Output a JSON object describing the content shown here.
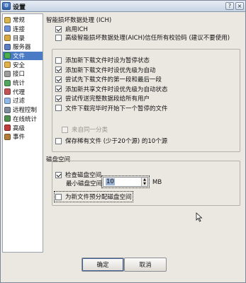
{
  "window": {
    "title": "设置",
    "icon": "app-icon"
  },
  "sidebar": {
    "items": [
      {
        "label": "常规",
        "icon": "general-icon",
        "color": "#d7b44c",
        "selected": false
      },
      {
        "label": "连接",
        "icon": "connection-icon",
        "color": "#6a8fd9",
        "selected": false
      },
      {
        "label": "目录",
        "icon": "folder-icon",
        "color": "#d7a842",
        "selected": false
      },
      {
        "label": "服务器",
        "icon": "server-icon",
        "color": "#5d7ec3",
        "selected": false
      },
      {
        "label": "文件",
        "icon": "file-icon",
        "color": "#4bb04b",
        "selected": true
      },
      {
        "label": "安全",
        "icon": "security-icon",
        "color": "#e0b04a",
        "selected": false
      },
      {
        "label": "接口",
        "icon": "interface-icon",
        "color": "#9d9d9d",
        "selected": false
      },
      {
        "label": "统计",
        "icon": "statistics-icon",
        "color": "#51a65e",
        "selected": false
      },
      {
        "label": "代理",
        "icon": "proxy-icon",
        "color": "#c45454",
        "selected": false
      },
      {
        "label": "过滤",
        "icon": "filter-icon",
        "color": "#8fb7e8",
        "selected": false
      },
      {
        "label": "远程控制",
        "icon": "remote-control-icon",
        "color": "#7f8fa0",
        "selected": false
      },
      {
        "label": "在线统计",
        "icon": "online-statistics-icon",
        "color": "#4f8f4f",
        "selected": false
      },
      {
        "label": "高级",
        "icon": "advanced-icon",
        "color": "#c23a3a",
        "selected": false
      },
      {
        "label": "事件",
        "icon": "events-icon",
        "color": "#b37d39",
        "selected": false
      }
    ]
  },
  "ich": {
    "title": "智能损坏数据处理 (ICH)",
    "enable_label": "启用ICH",
    "enable_checked": true,
    "aich_label": "高级智能损坏数据处理(AICH)信任所有校验码 (建议不要使用)",
    "aich_checked": false
  },
  "files": {
    "options": [
      {
        "label": "添加新下载文件时设为暂停状态",
        "checked": false
      },
      {
        "label": "添加新下载文件时设优先级为自动",
        "checked": true
      },
      {
        "label": "尝试先下载文件的第一段和最后一段",
        "checked": true
      },
      {
        "label": "添加新共享文件时设优先级为自动状态",
        "checked": true
      },
      {
        "label": "尝试传送完整数据段给所有用户",
        "checked": true
      },
      {
        "label": "文件下载完毕时开始下一个暂停的文件",
        "checked": false
      }
    ],
    "same_category_label": "来自同一分类",
    "same_category_checked": false,
    "rare_label": "保存稀有文件 (少于20个源) 的10个源",
    "rare_checked": false
  },
  "disk": {
    "title": "磁盘空间",
    "check_label": "检查磁盘空间",
    "check_checked": true,
    "min_label": "最小磁盘空间：",
    "min_value": "10",
    "min_unit": "MB",
    "prealloc_label": "为新文件预分配磁盘空间",
    "prealloc_checked": false
  },
  "buttons": {
    "ok": "确定",
    "cancel": "取消"
  }
}
